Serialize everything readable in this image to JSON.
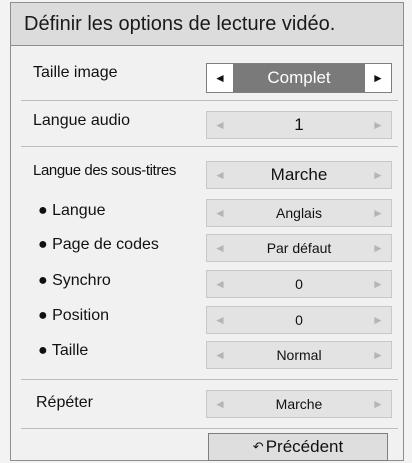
{
  "title": "Définir les options de lecture vidéo.",
  "settings": [
    {
      "id": "taille-image",
      "label": "Taille image",
      "value": "Complet",
      "active": true
    },
    {
      "id": "langue-audio",
      "label": "Langue audio",
      "value": "1"
    },
    {
      "id": "langue-sous-titres",
      "label": "Langue des sous-titres",
      "value": "Marche"
    },
    {
      "id": "langue",
      "label": "● Langue",
      "value": "Anglais"
    },
    {
      "id": "page-de-codes",
      "label": "● Page de codes",
      "value": "Par défaut"
    },
    {
      "id": "synchro",
      "label": "● Synchro",
      "value": "0"
    },
    {
      "id": "position",
      "label": "● Position",
      "value": "0"
    },
    {
      "id": "taille",
      "label": "● Taille",
      "value": "Normal"
    },
    {
      "id": "repeter",
      "label": "Répéter",
      "value": "Marche"
    }
  ],
  "arrows": {
    "left": "◄",
    "right": "►"
  },
  "back": {
    "icon": "↶",
    "label": "Précédent"
  }
}
